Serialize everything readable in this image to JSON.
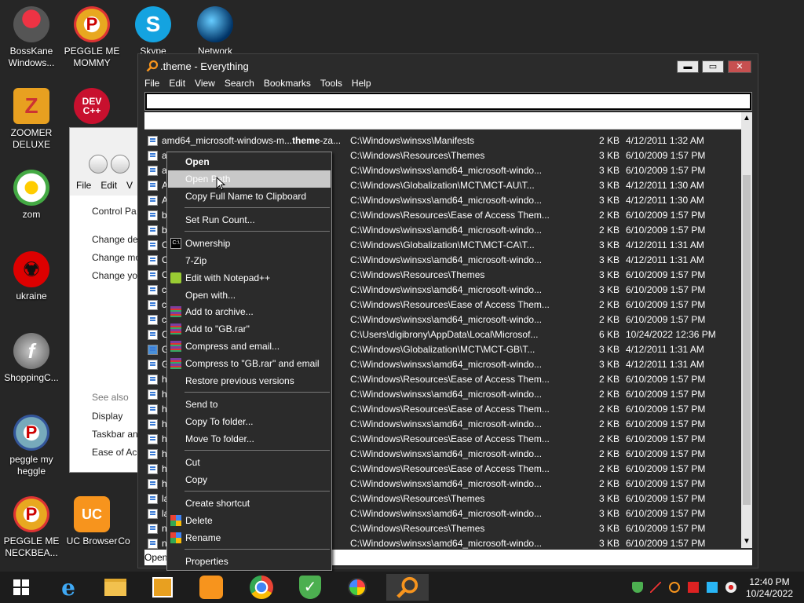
{
  "desktop": {
    "icons": [
      {
        "label": "BossKane Windows..."
      },
      {
        "label": "PEGGLE ME MOMMY"
      },
      {
        "label": "Skype"
      },
      {
        "label": "Network"
      },
      {
        "label": "ZOOMER DELUXE"
      },
      {
        "label": "DEV C++"
      },
      {
        "label": "zom"
      },
      {
        "label": "ukraine"
      },
      {
        "label": "ShoppingC..."
      },
      {
        "label": "peggle my heggle"
      },
      {
        "label": "PEGGLE ME NECKBEA..."
      },
      {
        "label": "UC Browser"
      },
      {
        "label": "Co"
      }
    ]
  },
  "bg_window": {
    "menu": [
      "File",
      "Edit",
      "V"
    ],
    "items": [
      "Control Pa",
      "Change de",
      "Change mo",
      "Change yo"
    ],
    "see_also": "See also",
    "links": [
      "Display",
      "Taskbar an",
      "Ease of Acc"
    ]
  },
  "window": {
    "title": ".theme - Everything",
    "controls": {
      "minimize": "▬",
      "maximize": "▭",
      "close": "✕"
    },
    "menu": [
      "File",
      "Edit",
      "View",
      "Search",
      "Bookmarks",
      "Tools",
      "Help"
    ],
    "search_value": "",
    "status": "Open"
  },
  "files": [
    {
      "name_pre": "amd64_microsoft-windows-m..",
      "name_bold": "theme",
      "name_post": "-za...",
      "path": "C:\\Windows\\winsxs\\Manifests",
      "size": "2 KB",
      "date": "4/12/2011 1:32 AM"
    },
    {
      "name": "a",
      "path": "C:\\Windows\\Resources\\Themes",
      "size": "3 KB",
      "date": "6/10/2009 1:57 PM"
    },
    {
      "name": "a",
      "path": "C:\\Windows\\winsxs\\amd64_microsoft-windo...",
      "size": "3 KB",
      "date": "6/10/2009 1:57 PM"
    },
    {
      "name": "A",
      "path": "C:\\Windows\\Globalization\\MCT\\MCT-AU\\T...",
      "size": "3 KB",
      "date": "4/12/2011 1:30 AM"
    },
    {
      "name": "A",
      "path": "C:\\Windows\\winsxs\\amd64_microsoft-windo...",
      "size": "3 KB",
      "date": "4/12/2011 1:30 AM"
    },
    {
      "name": "b",
      "path": "C:\\Windows\\Resources\\Ease of Access Them...",
      "size": "2 KB",
      "date": "6/10/2009 1:57 PM"
    },
    {
      "name": "b",
      "path": "C:\\Windows\\winsxs\\amd64_microsoft-windo...",
      "size": "2 KB",
      "date": "6/10/2009 1:57 PM"
    },
    {
      "name": "C",
      "path": "C:\\Windows\\Globalization\\MCT\\MCT-CA\\T...",
      "size": "3 KB",
      "date": "4/12/2011 1:31 AM"
    },
    {
      "name": "C",
      "path": "C:\\Windows\\winsxs\\amd64_microsoft-windo...",
      "size": "3 KB",
      "date": "4/12/2011 1:31 AM"
    },
    {
      "name": "C",
      "path": "C:\\Windows\\Resources\\Themes",
      "size": "3 KB",
      "date": "6/10/2009 1:57 PM"
    },
    {
      "name": "c",
      "path": "C:\\Windows\\winsxs\\amd64_microsoft-windo...",
      "size": "3 KB",
      "date": "6/10/2009 1:57 PM"
    },
    {
      "name": "c",
      "path": "C:\\Windows\\Resources\\Ease of Access Them...",
      "size": "2 KB",
      "date": "6/10/2009 1:57 PM"
    },
    {
      "name": "c",
      "path": "C:\\Windows\\winsxs\\amd64_microsoft-windo...",
      "size": "2 KB",
      "date": "6/10/2009 1:57 PM"
    },
    {
      "name": "C",
      "path": "C:\\Users\\digibrony\\AppData\\Local\\Microsof...",
      "size": "6 KB",
      "date": "10/24/2022 12:36 PM"
    },
    {
      "name": "G",
      "path": "C:\\Windows\\Globalization\\MCT\\MCT-GB\\T...",
      "size": "3 KB",
      "date": "4/12/2011 1:31 AM"
    },
    {
      "name": "G",
      "path": "C:\\Windows\\winsxs\\amd64_microsoft-windo...",
      "size": "3 KB",
      "date": "4/12/2011 1:31 AM"
    },
    {
      "name": "h",
      "path": "C:\\Windows\\Resources\\Ease of Access Them...",
      "size": "2 KB",
      "date": "6/10/2009 1:57 PM"
    },
    {
      "name": "h",
      "path": "C:\\Windows\\winsxs\\amd64_microsoft-windo...",
      "size": "2 KB",
      "date": "6/10/2009 1:57 PM"
    },
    {
      "name": "h",
      "path": "C:\\Windows\\Resources\\Ease of Access Them...",
      "size": "2 KB",
      "date": "6/10/2009 1:57 PM"
    },
    {
      "name": "h",
      "path": "C:\\Windows\\winsxs\\amd64_microsoft-windo...",
      "size": "2 KB",
      "date": "6/10/2009 1:57 PM"
    },
    {
      "name": "h",
      "path": "C:\\Windows\\Resources\\Ease of Access Them...",
      "size": "2 KB",
      "date": "6/10/2009 1:57 PM"
    },
    {
      "name": "h",
      "path": "C:\\Windows\\winsxs\\amd64_microsoft-windo...",
      "size": "2 KB",
      "date": "6/10/2009 1:57 PM"
    },
    {
      "name": "h",
      "path": "C:\\Windows\\Resources\\Ease of Access Them...",
      "size": "2 KB",
      "date": "6/10/2009 1:57 PM"
    },
    {
      "name": "h",
      "path": "C:\\Windows\\winsxs\\amd64_microsoft-windo...",
      "size": "2 KB",
      "date": "6/10/2009 1:57 PM"
    },
    {
      "name": "la",
      "path": "C:\\Windows\\Resources\\Themes",
      "size": "3 KB",
      "date": "6/10/2009 1:57 PM"
    },
    {
      "name": "la",
      "path": "C:\\Windows\\winsxs\\amd64_microsoft-windo...",
      "size": "3 KB",
      "date": "6/10/2009 1:57 PM"
    },
    {
      "name": "n",
      "path": "C:\\Windows\\Resources\\Themes",
      "size": "3 KB",
      "date": "6/10/2009 1:57 PM"
    },
    {
      "name": "n",
      "path": "C:\\Windows\\winsxs\\amd64_microsoft-windo...",
      "size": "3 KB",
      "date": "6/10/2009 1:57 PM"
    }
  ],
  "context_menu": {
    "items": [
      {
        "label": "Open",
        "bold": true
      },
      {
        "label": "Open Path",
        "highlight": true
      },
      {
        "label": "Copy Full Name to Clipboard"
      },
      {
        "label": "Set Run Count..."
      },
      {
        "label": "Ownership",
        "icon": "cmd-icon"
      },
      {
        "label": "7-Zip"
      },
      {
        "label": "Edit with Notepad++",
        "icon": "notepadpp-icon"
      },
      {
        "label": "Open with..."
      },
      {
        "label": "Add to archive...",
        "icon": "winrar-icon"
      },
      {
        "label": "Add to \"GB.rar\"",
        "icon": "winrar-icon"
      },
      {
        "label": "Compress and email...",
        "icon": "winrar-icon"
      },
      {
        "label": "Compress to \"GB.rar\" and email",
        "icon": "winrar-icon"
      },
      {
        "label": "Restore previous versions"
      },
      {
        "label": "Send to"
      },
      {
        "label": "Copy To folder..."
      },
      {
        "label": "Move To folder..."
      },
      {
        "label": "Cut"
      },
      {
        "label": "Copy"
      },
      {
        "label": "Create shortcut"
      },
      {
        "label": "Delete",
        "icon": "shield-icon"
      },
      {
        "label": "Rename",
        "icon": "shield-icon"
      },
      {
        "label": "Properties"
      }
    ]
  },
  "taskbar": {
    "time": "12:40 PM",
    "date": "10/24/2022"
  },
  "colors": {
    "accent_orange": "#f7941d",
    "window_bg": "#2b2b2b",
    "highlight": "#c8c8c8",
    "close_red": "#c75050"
  }
}
